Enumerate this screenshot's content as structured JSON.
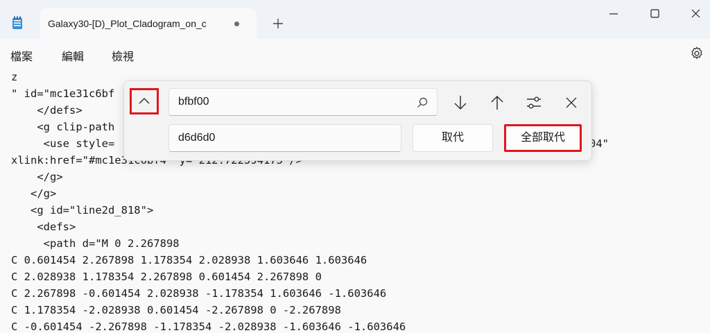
{
  "window": {
    "tab_title": "Galaxy30-[D)_Plot_Cladogram_on_c",
    "tab_unsaved_indicator": "dot",
    "new_tab_icon": "plus-icon",
    "app_icon": "notepad-icon"
  },
  "menu": {
    "file": "檔案",
    "edit": "編輯",
    "view": "檢視",
    "settings_icon": "gear-icon"
  },
  "find_panel": {
    "find_value": "bfbf00",
    "replace_value": "d6d6d0",
    "replace_label": "取代",
    "replace_all_label": "全部取代",
    "highlight_color": "#e0151e"
  },
  "editor": {
    "lines": [
      "z",
      "\" id=\"mc1e31c6bf",
      "    </defs>",
      "    <g clip-path",
      "     <use style=",
      "xlink:href=\"#mc1e31c6bf4\" y=\"212.722594175\"/>",
      "    </g>",
      "   </g>",
      "   <g id=\"line2d_818\">",
      "    <defs>",
      "     <path d=\"M 0 2.267898",
      "C 0.601454 2.267898 1.178354 2.028938 1.603646 1.603646",
      "C 2.028938 1.178354 2.267898 0.601454 2.267898 0",
      "C 2.267898 -0.601454 2.028938 -1.178354 1.603646 -1.603646",
      "C 1.178354 -2.028938 0.601454 -2.267898 0 -2.267898",
      "C -0.601454 -2.267898 -1.178354 -2.028938 -1.603646 -1.603646"
    ],
    "overflow_fragment": "04\""
  }
}
